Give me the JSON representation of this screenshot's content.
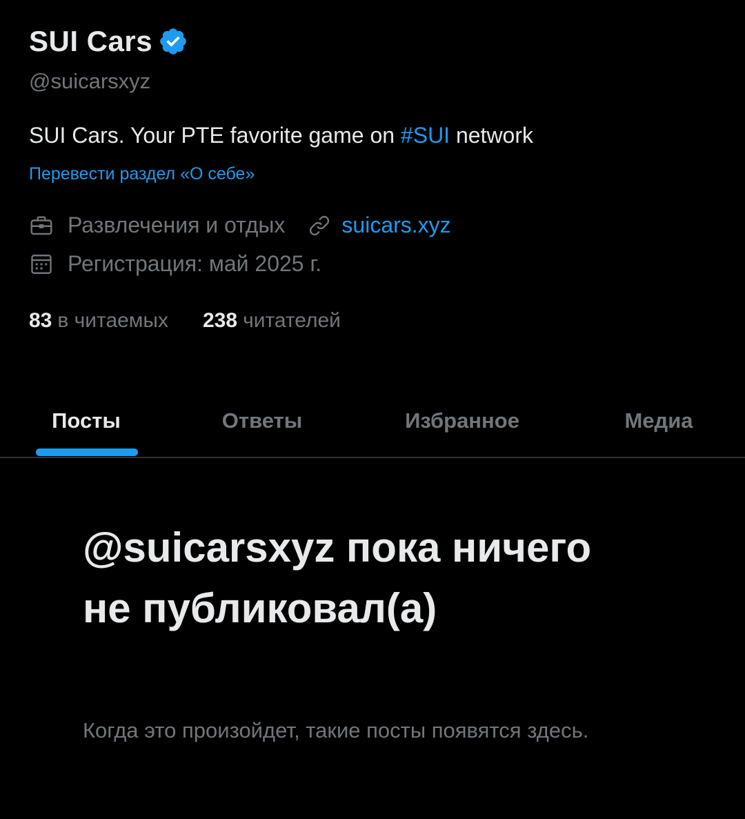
{
  "profile": {
    "display_name": "SUI Cars",
    "handle": "@suicarsxyz",
    "bio_prefix": "SUI Cars. Your PTE favorite game on ",
    "bio_hashtag": "#SUI",
    "bio_suffix": " network",
    "translate_label": "Перевести раздел «О себе»",
    "category": "Развлечения и отдых",
    "website": "suicars.xyz",
    "joined": "Регистрация: май 2025 г.",
    "icons": {
      "verified": "verified-badge-icon",
      "category": "briefcase-icon",
      "website": "link-icon",
      "joined": "calendar-icon"
    }
  },
  "stats": {
    "following_count": "83",
    "following_label": "в читаемых",
    "followers_count": "238",
    "followers_label": "читателей"
  },
  "tabs": [
    {
      "label": "Посты",
      "active": true
    },
    {
      "label": "Ответы",
      "active": false
    },
    {
      "label": "Избранное",
      "active": false
    },
    {
      "label": "Медиа",
      "active": false
    }
  ],
  "empty_state": {
    "title": "@suicarsxyz пока ничего не публиковал(а)",
    "subtitle": "Когда это произойдет, такие посты появятся здесь."
  },
  "colors": {
    "background": "#000000",
    "text_primary": "#e7e9ea",
    "text_secondary": "#71767b",
    "accent": "#1d9bf0",
    "divider": "#2f3336"
  }
}
